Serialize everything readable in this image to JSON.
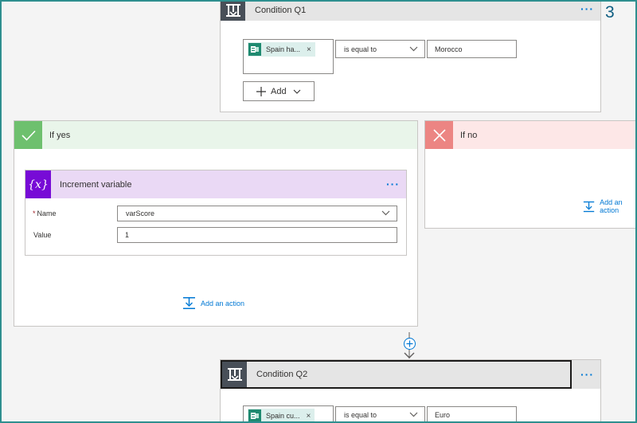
{
  "condition_q1": {
    "title": "Condition Q1",
    "more_label": "···",
    "token_label": "Spain ha...",
    "token_remove": "×",
    "operator": "is equal to",
    "value": "Morocco",
    "add_label": "Add"
  },
  "step_badge": "3",
  "if_yes": {
    "title": "If yes",
    "add_action_label": "Add an action"
  },
  "increment_variable": {
    "icon_text": "{x}",
    "title": "Increment variable",
    "more_label": "···",
    "name_label": "Name",
    "required_mark": "*",
    "name_value": "varScore",
    "value_label": "Value",
    "value_value": "1"
  },
  "if_no": {
    "title": "If no",
    "add_action_label": "Add an action"
  },
  "condition_q2": {
    "title": "Condition Q2",
    "more_label": "···",
    "token_label": "Spain cu...",
    "token_remove": "×",
    "operator": "is equal to",
    "value": "Euro"
  },
  "colors": {
    "accent": "#0078d4",
    "frame": "#2e8f8f",
    "yes_header": "#e9f5ea",
    "yes_icon": "#6ec06e",
    "no_header": "#fde7e7",
    "no_icon": "#ec8583",
    "variable_header": "#ead9f5",
    "variable_icon": "#770bd6"
  }
}
